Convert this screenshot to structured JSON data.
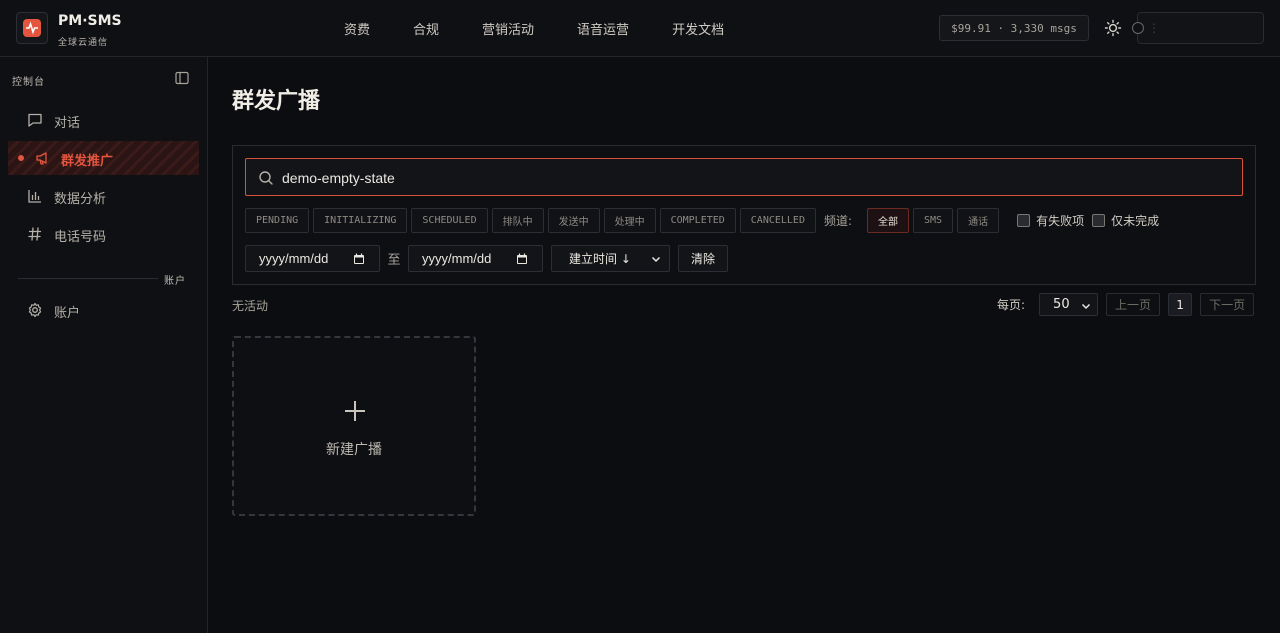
{
  "brand": {
    "name": "PM·SMS",
    "subtitle": "全球云通信"
  },
  "nav": {
    "items": [
      "资费",
      "合规",
      "营销活动",
      "语音运营",
      "开发文档"
    ]
  },
  "header": {
    "balance": "$99.91 · 3,330 msgs"
  },
  "sidebar": {
    "title": "控制台",
    "items": [
      {
        "label": "对话",
        "icon": "chat-icon"
      },
      {
        "label": "群发推广",
        "icon": "megaphone-icon",
        "active": true
      },
      {
        "label": "数据分析",
        "icon": "chart-icon"
      },
      {
        "label": "电话号码",
        "icon": "hash-icon"
      }
    ],
    "section": "账户",
    "account": {
      "label": "账户",
      "icon": "gear-icon"
    }
  },
  "page": {
    "title": "群发广播"
  },
  "filters": {
    "search_value": "demo-empty-state",
    "status_chips": [
      "PENDING",
      "INITIALIZING",
      "SCHEDULED",
      "排队中",
      "发送中",
      "处理中",
      "COMPLETED",
      "CANCELLED"
    ],
    "channel_label": "频道:",
    "channel_chips": [
      "全部",
      "SMS",
      "通话"
    ],
    "checkbox_failed": "有失败项",
    "checkbox_incomplete": "仅未完成",
    "date_placeholder": "yyyy/mm/dd",
    "date_to": "至",
    "sort_value": "建立时间 ↓",
    "clear_label": "清除"
  },
  "results": {
    "status": "无活动"
  },
  "pager": {
    "per_page_label": "每页:",
    "per_page_value": "50",
    "prev": "上一页",
    "page": "1",
    "next": "下一页"
  },
  "new_card": {
    "label": "新建广播"
  },
  "colors": {
    "accent": "#e4553f",
    "background": "#0c0d10"
  }
}
